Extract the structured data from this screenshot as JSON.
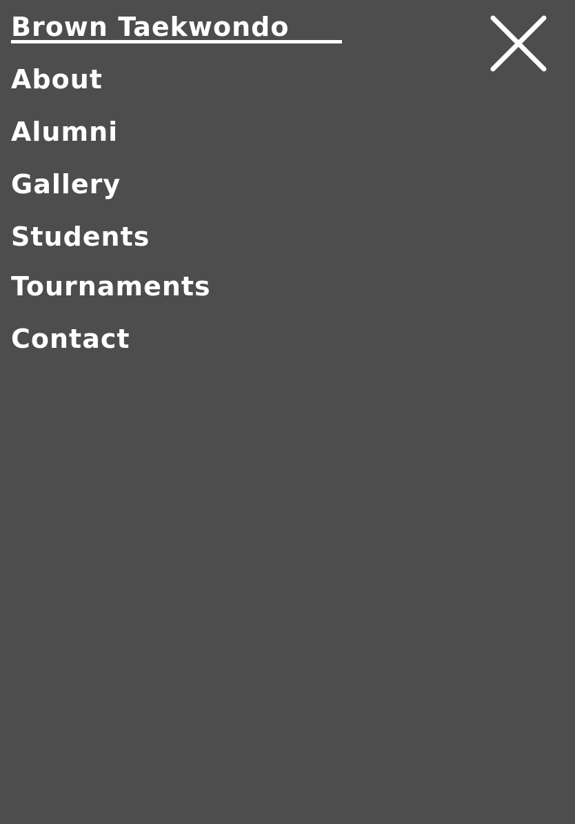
{
  "site": {
    "title": "Brown Taekwondo"
  },
  "nav": {
    "items": [
      {
        "label": "About"
      },
      {
        "label": "Alumni"
      },
      {
        "label": "Gallery"
      },
      {
        "label": "Students"
      },
      {
        "label": "Tournaments"
      },
      {
        "label": "Contact"
      }
    ]
  },
  "close_icon": "close-icon",
  "colors": {
    "background": "#4d4d4d",
    "text": "#ffffff"
  }
}
